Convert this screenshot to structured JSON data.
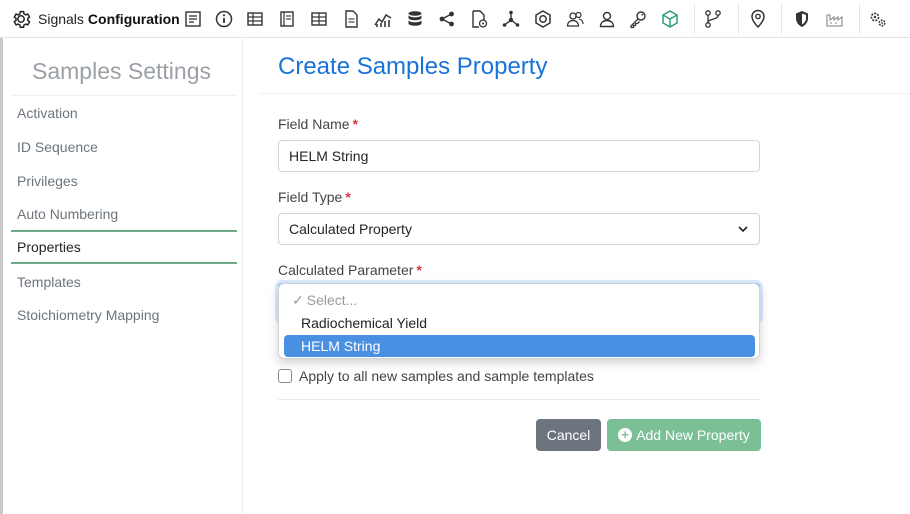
{
  "app": {
    "brand_prefix": "Signals",
    "brand_bold": "Configuration"
  },
  "toolbar": {
    "icons": [
      "form-icon",
      "info-icon",
      "table-icon",
      "notebook-icon",
      "grid-icon",
      "document-icon",
      "chart-icon",
      "database-icon",
      "share-icon",
      "file-settings-icon",
      "molecule-icon",
      "hexagon-icon",
      "users-icon",
      "user-icon",
      "key-icon",
      "cube-icon",
      "workflow-icon",
      "location-icon",
      "shield-icon",
      "factory-icon",
      "gears-icon"
    ],
    "accent_icon_color": "#2e9a7c"
  },
  "sidebar": {
    "title": "Samples Settings",
    "items": [
      {
        "label": "Activation",
        "active": false
      },
      {
        "label": "ID Sequence",
        "active": false
      },
      {
        "label": "Privileges",
        "active": false
      },
      {
        "label": "Auto Numbering",
        "active": false
      },
      {
        "label": "Properties",
        "active": true
      },
      {
        "label": "Templates",
        "active": false
      },
      {
        "label": "Stoichiometry Mapping",
        "active": false
      }
    ]
  },
  "form": {
    "title": "Create Samples Property",
    "required_mark": "*",
    "field_name": {
      "label": "Field Name",
      "value": "HELM String"
    },
    "field_type": {
      "label": "Field Type",
      "value": "Calculated Property"
    },
    "calc_param": {
      "label": "Calculated Parameter",
      "options": [
        {
          "label": "Select...",
          "checked": true,
          "highlighted": false
        },
        {
          "label": "Radiochemical Yield",
          "checked": false,
          "highlighted": false
        },
        {
          "label": "HELM String",
          "checked": false,
          "highlighted": true
        }
      ]
    },
    "apply_all": {
      "label": "Apply to all new samples and sample templates",
      "checked": false
    },
    "cancel_label": "Cancel",
    "add_label": "Add New Property"
  },
  "colors": {
    "title_blue": "#1a73d9",
    "active_underline": "#6fa889",
    "add_button": "#7bbf97",
    "cancel_button": "#6c757d",
    "highlight": "#4a90e2",
    "required": "#dc3545"
  }
}
